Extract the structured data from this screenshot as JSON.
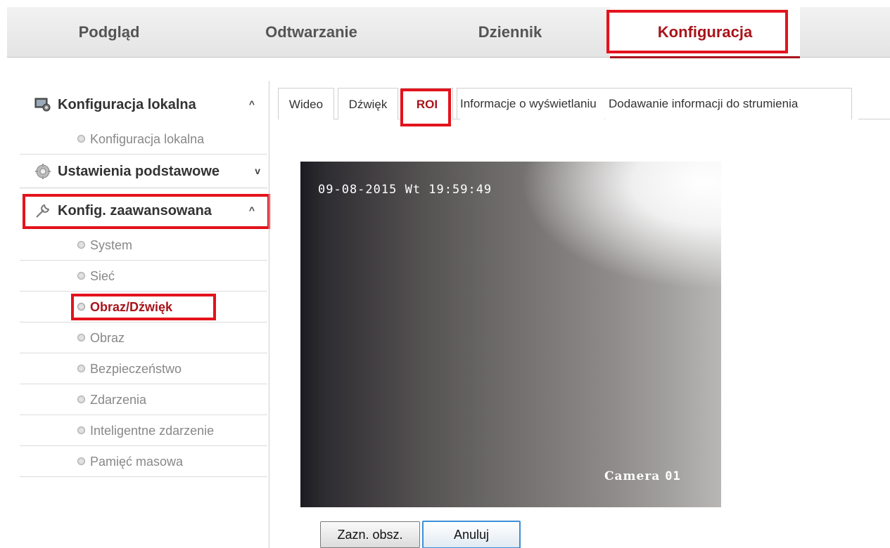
{
  "topnav": {
    "tabs": [
      {
        "label": "Podgląd"
      },
      {
        "label": "Odtwarzanie"
      },
      {
        "label": "Dziennik"
      },
      {
        "label": "Konfiguracja",
        "active": true
      }
    ]
  },
  "sidebar": {
    "sections": [
      {
        "label": "Konfiguracja lokalna",
        "icon": "local-config-icon",
        "chevron": "^",
        "items": [
          {
            "label": "Konfiguracja lokalna"
          }
        ]
      },
      {
        "label": "Ustawienia podstawowe",
        "icon": "gear-icon",
        "chevron": "v",
        "items": []
      },
      {
        "label": "Konfig. zaawansowana",
        "icon": "wrench-icon",
        "chevron": "^",
        "items": [
          {
            "label": "System"
          },
          {
            "label": "Sieć"
          },
          {
            "label": "Obraz/Dźwięk",
            "active": true
          },
          {
            "label": "Obraz"
          },
          {
            "label": "Bezpieczeństwo"
          },
          {
            "label": "Zdarzenia"
          },
          {
            "label": "Inteligentne zdarzenie"
          },
          {
            "label": "Pamięć masowa"
          }
        ]
      }
    ]
  },
  "content_tabs": [
    {
      "label": "Wideo"
    },
    {
      "label": "Dźwięk"
    },
    {
      "label": "ROI",
      "active": true
    },
    {
      "label": "Informacje o wyświetlaniu"
    },
    {
      "label": "Dodawanie informacji do strumienia"
    }
  ],
  "video": {
    "osd_datetime": "09-08-2015 Wt  19:59:49",
    "osd_camera_prefix": "Camera",
    "osd_camera_num": "01"
  },
  "buttons": {
    "draw_area": "Zazn. obsz.",
    "cancel": "Anuluj"
  },
  "colors": {
    "accent": "#a8141b",
    "highlight_box": "#e3131c"
  }
}
